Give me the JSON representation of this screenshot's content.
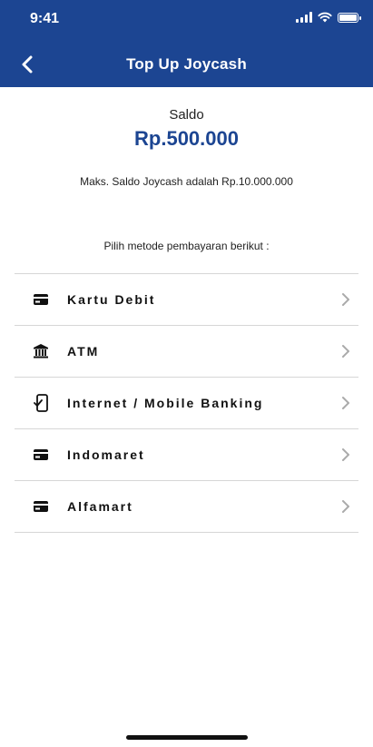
{
  "status_bar": {
    "time": "9:41"
  },
  "header": {
    "title": "Top Up Joycash",
    "back_icon": "chevron-left-icon",
    "background": "#1c4592"
  },
  "balance": {
    "label": "Saldo",
    "value": "Rp.500.000",
    "color": "#1c4592"
  },
  "max_note": "Maks. Saldo Joycash adalah Rp.10.000.000",
  "method_prompt": "Pilih metode pembayaran berikut :",
  "methods": [
    {
      "label": "Kartu Debit",
      "icon": "card-icon"
    },
    {
      "label": "ATM",
      "icon": "bank-icon"
    },
    {
      "label": "Internet / Mobile Banking",
      "icon": "mobile-check-icon"
    },
    {
      "label": "Indomaret",
      "icon": "card-icon"
    },
    {
      "label": "Alfamart",
      "icon": "card-icon"
    }
  ]
}
